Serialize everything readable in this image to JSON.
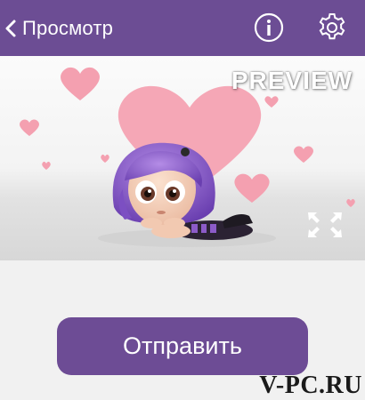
{
  "colors": {
    "header": "#6c4d94",
    "button": "#6d4c95",
    "heart": "#f4a0b0",
    "background": "#f1f1f1"
  },
  "header": {
    "back_label": "Просмотр",
    "icons": [
      "chevron-left-icon",
      "info-icon",
      "gear-icon"
    ]
  },
  "preview": {
    "badge": "PREVIEW",
    "sticker": "purple-haired-girl-with-hearts",
    "fullscreen_icon": "expand-icon"
  },
  "actions": {
    "send_label": "Отправить"
  },
  "watermark": "V-PC.RU"
}
